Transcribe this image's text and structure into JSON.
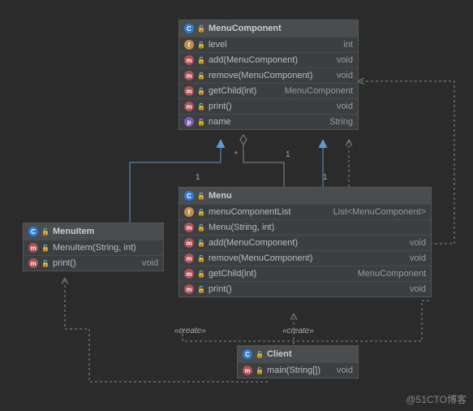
{
  "classes": {
    "menuComponent": {
      "name": "MenuComponent",
      "members": [
        {
          "icon": "f",
          "name": "level",
          "ret": "int"
        },
        {
          "icon": "m",
          "name": "add(MenuComponent)",
          "ret": "void"
        },
        {
          "icon": "m",
          "name": "remove(MenuComponent)",
          "ret": "void"
        },
        {
          "icon": "m",
          "name": "getChild(int)",
          "ret": "MenuComponent"
        },
        {
          "icon": "m",
          "name": "print()",
          "ret": "void"
        },
        {
          "icon": "p",
          "name": "name",
          "ret": "String"
        }
      ]
    },
    "menu": {
      "name": "Menu",
      "members": [
        {
          "icon": "f",
          "lock": true,
          "name": "menuComponentList",
          "ret": "List<MenuComponent>"
        },
        {
          "icon": "m",
          "name": "Menu(String, int)",
          "ret": ""
        },
        {
          "icon": "m",
          "name": "add(MenuComponent)",
          "ret": "void"
        },
        {
          "icon": "m",
          "name": "remove(MenuComponent)",
          "ret": "void"
        },
        {
          "icon": "m",
          "name": "getChild(int)",
          "ret": "MenuComponent"
        },
        {
          "icon": "m",
          "name": "print()",
          "ret": "void"
        }
      ]
    },
    "menuItem": {
      "name": "MenuItem",
      "members": [
        {
          "icon": "m",
          "name": "MenuItem(String, int)",
          "ret": ""
        },
        {
          "icon": "m",
          "name": "print()",
          "ret": "void"
        }
      ]
    },
    "client": {
      "name": "Client",
      "members": [
        {
          "icon": "m",
          "name": "main(String[])",
          "ret": "void"
        }
      ]
    }
  },
  "labels": {
    "create1": "«create»",
    "create2": "«create»"
  },
  "mult": {
    "one1": "1",
    "star": "*",
    "one2": "1",
    "one3": "1"
  },
  "watermark": "@51CTO博客"
}
